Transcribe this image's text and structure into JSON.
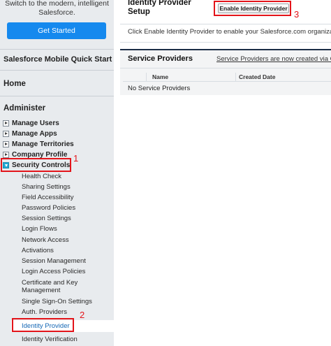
{
  "promo": {
    "line1": "Switch to the modern, intelligent",
    "line2": "Salesforce.",
    "button": "Get Started"
  },
  "sidebar": {
    "quick_start": "Salesforce Mobile Quick Start",
    "home": "Home",
    "administer": "Administer",
    "groups": [
      {
        "label": "Manage Users"
      },
      {
        "label": "Manage Apps"
      },
      {
        "label": "Manage Territories"
      },
      {
        "label": "Company Profile"
      },
      {
        "label": "Security Controls"
      }
    ],
    "security_items": [
      {
        "label": "Health Check"
      },
      {
        "label": "Sharing Settings"
      },
      {
        "label": "Field Accessibility"
      },
      {
        "label": "Password Policies"
      },
      {
        "label": "Session Settings"
      },
      {
        "label": "Login Flows"
      },
      {
        "label": "Network Access"
      },
      {
        "label": "Activations"
      },
      {
        "label": "Session Management"
      },
      {
        "label": "Login Access Policies"
      },
      {
        "label": "Certificate and Key Management"
      },
      {
        "label": "Single Sign-On Settings"
      },
      {
        "label": "Auth. Providers"
      },
      {
        "label": "Identity Provider"
      },
      {
        "label": "Identity Verification"
      }
    ]
  },
  "main": {
    "title": "Identity Provider Setup",
    "enable_button": "Enable Identity Provider",
    "intro": "Click Enable Identity Provider to enable your Salesforce.com organizatio",
    "service_providers": {
      "title": "Service Providers",
      "note": "Service Providers are now created via Co",
      "columns": [
        "Name",
        "Created Date"
      ],
      "empty": "No Service Providers"
    }
  },
  "annotations": {
    "one": "1",
    "two": "2",
    "three": "3",
    "color": "#e3141a"
  },
  "colors": {
    "accent": "#1589ee",
    "link": "#1568b5",
    "sidebar_bg": "#e8ebee",
    "panel_border": "#1b2d46"
  }
}
